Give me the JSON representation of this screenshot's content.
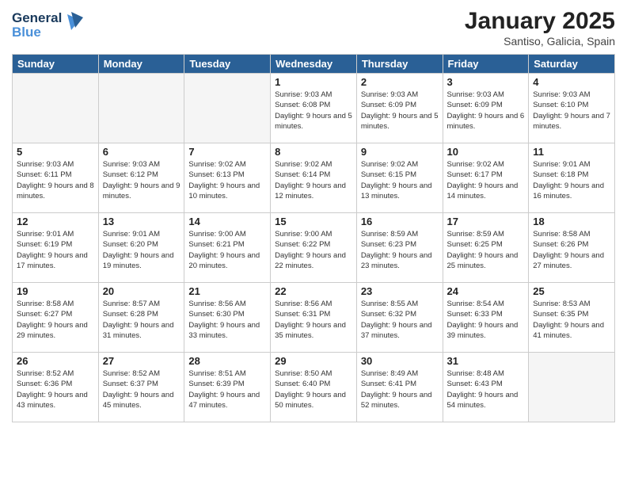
{
  "logo": {
    "line1": "General",
    "line2": "Blue"
  },
  "title": "January 2025",
  "subtitle": "Santiso, Galicia, Spain",
  "days_header": [
    "Sunday",
    "Monday",
    "Tuesday",
    "Wednesday",
    "Thursday",
    "Friday",
    "Saturday"
  ],
  "weeks": [
    [
      {
        "num": "",
        "info": ""
      },
      {
        "num": "",
        "info": ""
      },
      {
        "num": "",
        "info": ""
      },
      {
        "num": "1",
        "info": "Sunrise: 9:03 AM\nSunset: 6:08 PM\nDaylight: 9 hours and 5 minutes."
      },
      {
        "num": "2",
        "info": "Sunrise: 9:03 AM\nSunset: 6:09 PM\nDaylight: 9 hours and 5 minutes."
      },
      {
        "num": "3",
        "info": "Sunrise: 9:03 AM\nSunset: 6:09 PM\nDaylight: 9 hours and 6 minutes."
      },
      {
        "num": "4",
        "info": "Sunrise: 9:03 AM\nSunset: 6:10 PM\nDaylight: 9 hours and 7 minutes."
      }
    ],
    [
      {
        "num": "5",
        "info": "Sunrise: 9:03 AM\nSunset: 6:11 PM\nDaylight: 9 hours and 8 minutes."
      },
      {
        "num": "6",
        "info": "Sunrise: 9:03 AM\nSunset: 6:12 PM\nDaylight: 9 hours and 9 minutes."
      },
      {
        "num": "7",
        "info": "Sunrise: 9:02 AM\nSunset: 6:13 PM\nDaylight: 9 hours and 10 minutes."
      },
      {
        "num": "8",
        "info": "Sunrise: 9:02 AM\nSunset: 6:14 PM\nDaylight: 9 hours and 12 minutes."
      },
      {
        "num": "9",
        "info": "Sunrise: 9:02 AM\nSunset: 6:15 PM\nDaylight: 9 hours and 13 minutes."
      },
      {
        "num": "10",
        "info": "Sunrise: 9:02 AM\nSunset: 6:17 PM\nDaylight: 9 hours and 14 minutes."
      },
      {
        "num": "11",
        "info": "Sunrise: 9:01 AM\nSunset: 6:18 PM\nDaylight: 9 hours and 16 minutes."
      }
    ],
    [
      {
        "num": "12",
        "info": "Sunrise: 9:01 AM\nSunset: 6:19 PM\nDaylight: 9 hours and 17 minutes."
      },
      {
        "num": "13",
        "info": "Sunrise: 9:01 AM\nSunset: 6:20 PM\nDaylight: 9 hours and 19 minutes."
      },
      {
        "num": "14",
        "info": "Sunrise: 9:00 AM\nSunset: 6:21 PM\nDaylight: 9 hours and 20 minutes."
      },
      {
        "num": "15",
        "info": "Sunrise: 9:00 AM\nSunset: 6:22 PM\nDaylight: 9 hours and 22 minutes."
      },
      {
        "num": "16",
        "info": "Sunrise: 8:59 AM\nSunset: 6:23 PM\nDaylight: 9 hours and 23 minutes."
      },
      {
        "num": "17",
        "info": "Sunrise: 8:59 AM\nSunset: 6:25 PM\nDaylight: 9 hours and 25 minutes."
      },
      {
        "num": "18",
        "info": "Sunrise: 8:58 AM\nSunset: 6:26 PM\nDaylight: 9 hours and 27 minutes."
      }
    ],
    [
      {
        "num": "19",
        "info": "Sunrise: 8:58 AM\nSunset: 6:27 PM\nDaylight: 9 hours and 29 minutes."
      },
      {
        "num": "20",
        "info": "Sunrise: 8:57 AM\nSunset: 6:28 PM\nDaylight: 9 hours and 31 minutes."
      },
      {
        "num": "21",
        "info": "Sunrise: 8:56 AM\nSunset: 6:30 PM\nDaylight: 9 hours and 33 minutes."
      },
      {
        "num": "22",
        "info": "Sunrise: 8:56 AM\nSunset: 6:31 PM\nDaylight: 9 hours and 35 minutes."
      },
      {
        "num": "23",
        "info": "Sunrise: 8:55 AM\nSunset: 6:32 PM\nDaylight: 9 hours and 37 minutes."
      },
      {
        "num": "24",
        "info": "Sunrise: 8:54 AM\nSunset: 6:33 PM\nDaylight: 9 hours and 39 minutes."
      },
      {
        "num": "25",
        "info": "Sunrise: 8:53 AM\nSunset: 6:35 PM\nDaylight: 9 hours and 41 minutes."
      }
    ],
    [
      {
        "num": "26",
        "info": "Sunrise: 8:52 AM\nSunset: 6:36 PM\nDaylight: 9 hours and 43 minutes."
      },
      {
        "num": "27",
        "info": "Sunrise: 8:52 AM\nSunset: 6:37 PM\nDaylight: 9 hours and 45 minutes."
      },
      {
        "num": "28",
        "info": "Sunrise: 8:51 AM\nSunset: 6:39 PM\nDaylight: 9 hours and 47 minutes."
      },
      {
        "num": "29",
        "info": "Sunrise: 8:50 AM\nSunset: 6:40 PM\nDaylight: 9 hours and 50 minutes."
      },
      {
        "num": "30",
        "info": "Sunrise: 8:49 AM\nSunset: 6:41 PM\nDaylight: 9 hours and 52 minutes."
      },
      {
        "num": "31",
        "info": "Sunrise: 8:48 AM\nSunset: 6:43 PM\nDaylight: 9 hours and 54 minutes."
      },
      {
        "num": "",
        "info": ""
      }
    ]
  ]
}
